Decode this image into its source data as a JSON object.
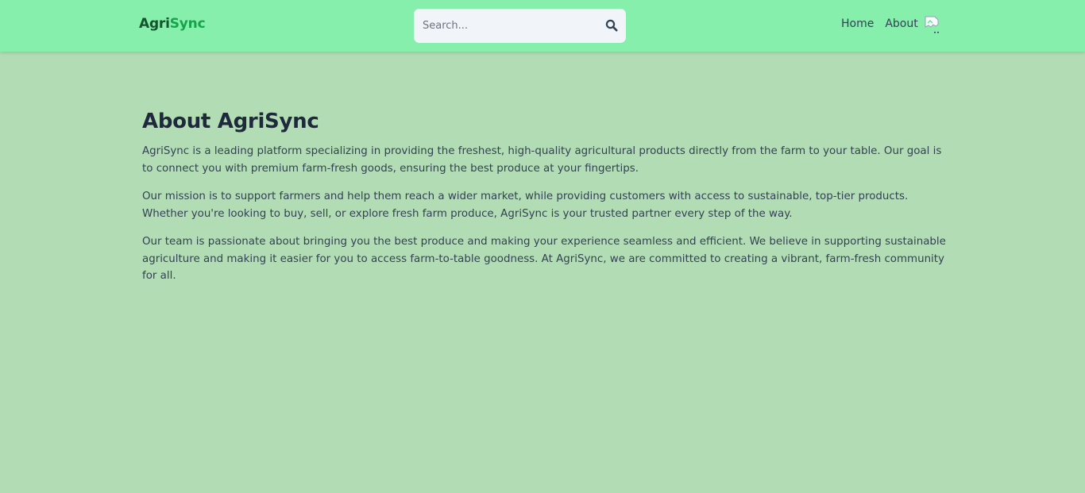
{
  "header": {
    "brand_part1": "Agri",
    "brand_part2": "Sync",
    "search_placeholder": "Search...",
    "search_icon": "search-icon",
    "nav": {
      "home_label": "Home",
      "about_label": "About"
    },
    "avatar_icon": "broken-image-icon"
  },
  "main": {
    "title": "About AgriSync",
    "paragraphs": [
      "AgriSync is a leading platform specializing in providing the freshest, high-quality agricultural products directly from the farm to your table. Our goal is to connect you with premium farm-fresh goods, ensuring the best produce at your fingertips.",
      "Our mission is to support farmers and help them reach a wider market, while providing customers with access to sustainable, top-tier products. Whether you're looking to buy, sell, or explore fresh farm produce, AgriSync is your trusted partner every step of the way.",
      "Our team is passionate about bringing you the best produce and making your experience seamless and efficient. We believe in supporting sustainable agriculture and making it easier for you to access farm-to-table goodness. At AgriSync, we are committed to creating a vibrant, farm-fresh community for all."
    ]
  },
  "colors": {
    "page_background": "#b2ddb4",
    "navbar_background": "#86efac",
    "brand_dark": "#14532d",
    "brand_accent": "#16a34a",
    "search_background": "#f1f5f9",
    "text_dark": "#1e293b",
    "text_body": "#334155"
  }
}
